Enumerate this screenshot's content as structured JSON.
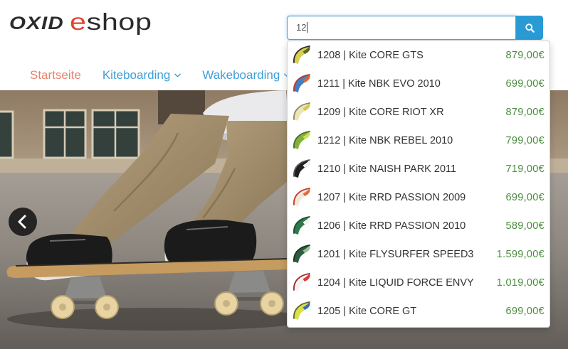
{
  "logo": {
    "part1": "OXID",
    "accent": "e",
    "rest": "shop"
  },
  "search": {
    "value": "12",
    "button_icon": "search-icon"
  },
  "nav": {
    "items": [
      {
        "label": "Startseite",
        "active": true
      },
      {
        "label": "Kiteboarding",
        "icon": "chevron-down-icon"
      },
      {
        "label": "Wakeboarding",
        "icon": "chevron-down-icon"
      }
    ]
  },
  "suggestions": [
    {
      "label": "1208 | Kite CORE GTS",
      "price": "879,00€",
      "thumb": {
        "icon": "kite-thumbnail-icon",
        "colors": [
          "#d8cf52",
          "#56652c",
          "#2b2b2b"
        ]
      }
    },
    {
      "label": "1211 | Kite NBK EVO 2010",
      "price": "699,00€",
      "thumb": {
        "icon": "kite-thumbnail-icon",
        "colors": [
          "#3f7fc4",
          "#e2652c",
          "#c2312c"
        ]
      }
    },
    {
      "label": "1209 | Kite CORE RIOT XR",
      "price": "879,00€",
      "thumb": {
        "icon": "kite-thumbnail-icon",
        "colors": [
          "#ebe6b4",
          "#d6c84c",
          "#8c8a68"
        ]
      }
    },
    {
      "label": "1212 | Kite NBK REBEL 2010",
      "price": "799,00€",
      "thumb": {
        "icon": "kite-thumbnail-icon",
        "colors": [
          "#86b03c",
          "#cfe04e",
          "#4a6b28"
        ]
      }
    },
    {
      "label": "1210 | Kite NAISH PARK 2011",
      "price": "719,00€",
      "thumb": {
        "icon": "kite-thumbnail-icon",
        "colors": [
          "#1f1f1f",
          "#f2f2f2",
          "#5a5a5a"
        ]
      }
    },
    {
      "label": "1207 | Kite RRD PASSION 2009",
      "price": "699,00€",
      "thumb": {
        "icon": "kite-thumbnail-icon",
        "colors": [
          "#f4e6da",
          "#e46b3a",
          "#c0392b"
        ]
      }
    },
    {
      "label": "1206 | Kite RRD PASSION 2010",
      "price": "589,00€",
      "thumb": {
        "icon": "kite-thumbnail-icon",
        "colors": [
          "#2f7a4a",
          "#f2f2f2",
          "#1d4a2d"
        ]
      }
    },
    {
      "label": "1201 | Kite FLYSURFER SPEED3",
      "price": "1.599,00€",
      "thumb": {
        "icon": "kite-thumbnail-icon",
        "colors": [
          "#2c5e3e",
          "#9cc09a",
          "#1a3324"
        ]
      }
    },
    {
      "label": "1204 | Kite LIQUID FORCE ENVY",
      "price": "1.019,00€",
      "thumb": {
        "icon": "kite-thumbnail-icon",
        "colors": [
          "#f2f2f2",
          "#d63a3a",
          "#9a2a2a"
        ]
      }
    },
    {
      "label": "1205 | Kite CORE GT",
      "price": "699,00€",
      "thumb": {
        "icon": "kite-thumbnail-icon",
        "colors": [
          "#d9e04a",
          "#3a6fb5",
          "#5a6a2a"
        ]
      }
    }
  ],
  "carousel": {
    "prev_icon": "chevron-left-icon"
  },
  "colors": {
    "accent_blue": "#2a9ad4",
    "nav_active": "#e8846a",
    "nav_link": "#3d9fd7",
    "price_green": "#4a8c3c",
    "logo_accent": "#e2432e",
    "text": "#333333"
  }
}
